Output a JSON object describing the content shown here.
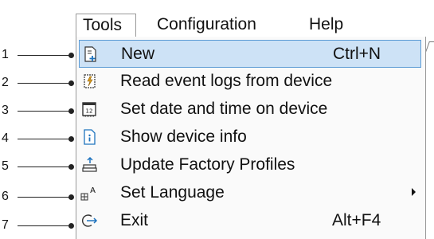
{
  "menubar": {
    "tools": "Tools",
    "configuration": "Configuration",
    "help": "Help"
  },
  "menu": {
    "items": [
      {
        "label": "New",
        "shortcut": "Ctrl+N",
        "icon": "new-document-icon",
        "highlighted": true
      },
      {
        "label": "Read event logs from device",
        "shortcut": "",
        "icon": "event-log-icon"
      },
      {
        "label": "Set date and time on device",
        "shortcut": "",
        "icon": "calendar-icon"
      },
      {
        "label": "Show device info",
        "shortcut": "",
        "icon": "info-document-icon"
      },
      {
        "label": "Update Factory Profiles",
        "shortcut": "",
        "icon": "upload-icon"
      },
      {
        "label": "Set Language",
        "shortcut": "",
        "icon": "language-icon",
        "submenu": true
      },
      {
        "label": "Exit",
        "shortcut": "Alt+F4",
        "icon": "exit-icon"
      }
    ]
  },
  "callouts": [
    "1",
    "2",
    "3",
    "4",
    "5",
    "6",
    "7"
  ],
  "colors": {
    "highlight_bg": "#cde2f6",
    "highlight_border": "#5b9bd5",
    "icon_blue": "#1e73be"
  }
}
